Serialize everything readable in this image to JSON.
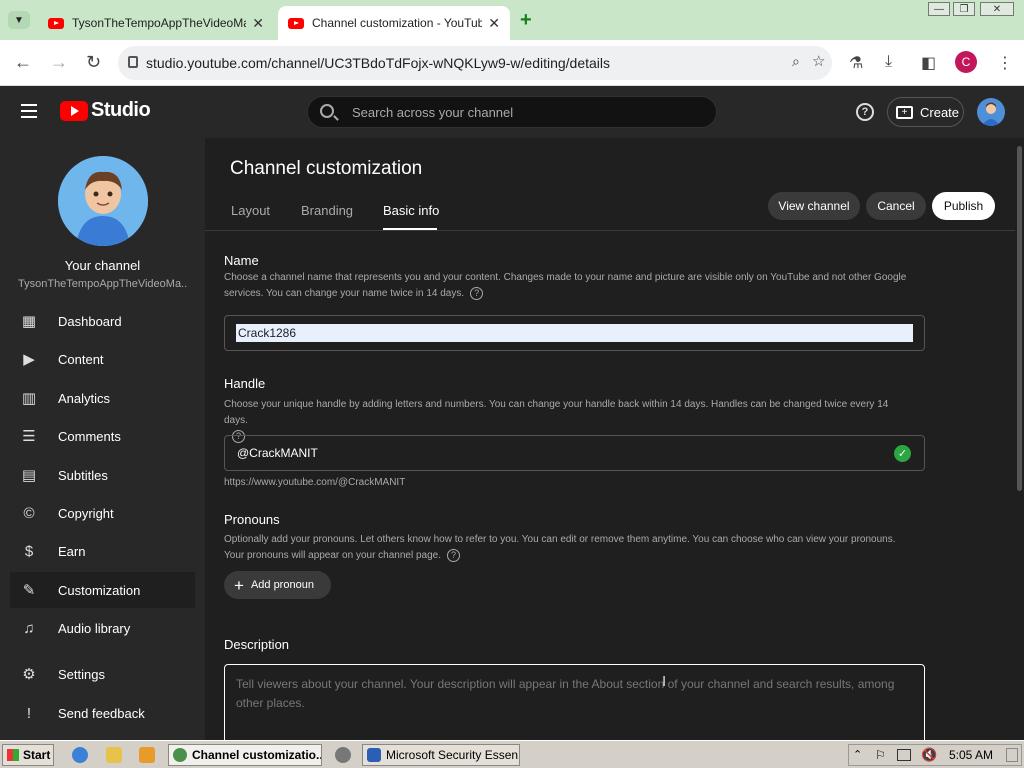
{
  "browser": {
    "tabs": [
      {
        "title": "TysonTheTempoAppTheVideoMaker",
        "active": false
      },
      {
        "title": "Channel customization - YouTube S",
        "active": true
      }
    ],
    "url": "studio.youtube.com/channel/UC3TBdoTdFojx-wNQKLyw9-w/editing/details",
    "profile_initial": "C"
  },
  "header": {
    "logo_text": "Studio",
    "search_placeholder": "Search across your channel",
    "create_label": "Create"
  },
  "sidebar": {
    "channel_label": "Your channel",
    "channel_name": "TysonTheTempoAppTheVideoMa...",
    "items": [
      {
        "label": "Dashboard",
        "icon": "dashboard-icon",
        "glyph": "▦"
      },
      {
        "label": "Content",
        "icon": "content-icon",
        "glyph": "▶"
      },
      {
        "label": "Analytics",
        "icon": "analytics-icon",
        "glyph": "▥"
      },
      {
        "label": "Comments",
        "icon": "comments-icon",
        "glyph": "☰"
      },
      {
        "label": "Subtitles",
        "icon": "subtitles-icon",
        "glyph": "▤"
      },
      {
        "label": "Copyright",
        "icon": "copyright-icon",
        "glyph": "©"
      },
      {
        "label": "Earn",
        "icon": "earn-icon",
        "glyph": "$"
      },
      {
        "label": "Customization",
        "icon": "customization-icon",
        "glyph": "✎"
      },
      {
        "label": "Audio library",
        "icon": "audio-library-icon",
        "glyph": "♫"
      },
      {
        "label": "Settings",
        "icon": "settings-icon",
        "glyph": "⚙"
      },
      {
        "label": "Send feedback",
        "icon": "feedback-icon",
        "glyph": "!"
      }
    ]
  },
  "main": {
    "title": "Channel customization",
    "tabs": [
      {
        "label": "Layout"
      },
      {
        "label": "Branding"
      },
      {
        "label": "Basic info"
      }
    ],
    "active_tab": "Basic info",
    "buttons": {
      "view_channel": "View channel",
      "cancel": "Cancel",
      "publish": "Publish"
    },
    "name": {
      "title": "Name",
      "description": "Choose a channel name that represents you and your content. Changes made to your name and picture are visible only on YouTube and not other Google services. You can change your name twice in 14 days.",
      "value": "Crack1286"
    },
    "handle": {
      "title": "Handle",
      "description": "Choose your unique handle by adding letters and numbers. You can change your handle back within 14 days. Handles can be changed twice every 14 days.",
      "value": "@CrackMANIT",
      "url": "https://www.youtube.com/@CrackMANIT"
    },
    "pronouns": {
      "title": "Pronouns",
      "description": "Optionally add your pronouns. Let others know how to refer to you. You can edit or remove them anytime. You can choose who can view your pronouns. Your pronouns will appear on your channel page.",
      "add_label": "Add pronoun"
    },
    "description": {
      "title": "Description",
      "placeholder": "Tell viewers about your channel. Your description will appear in the About section of your channel and search results, among other places."
    }
  },
  "taskbar": {
    "start_label": "Start",
    "tasks": [
      {
        "label": "Channel customizatio..."
      },
      {
        "label": "Microsoft Security Essen..."
      }
    ],
    "clock": "5:05 AM"
  },
  "colors": {
    "brand_red": "#ff0000",
    "studio_bg": "#1f1f1f",
    "success_green": "#2ba640",
    "chrome_tabstrip": "#c9e6c9"
  }
}
